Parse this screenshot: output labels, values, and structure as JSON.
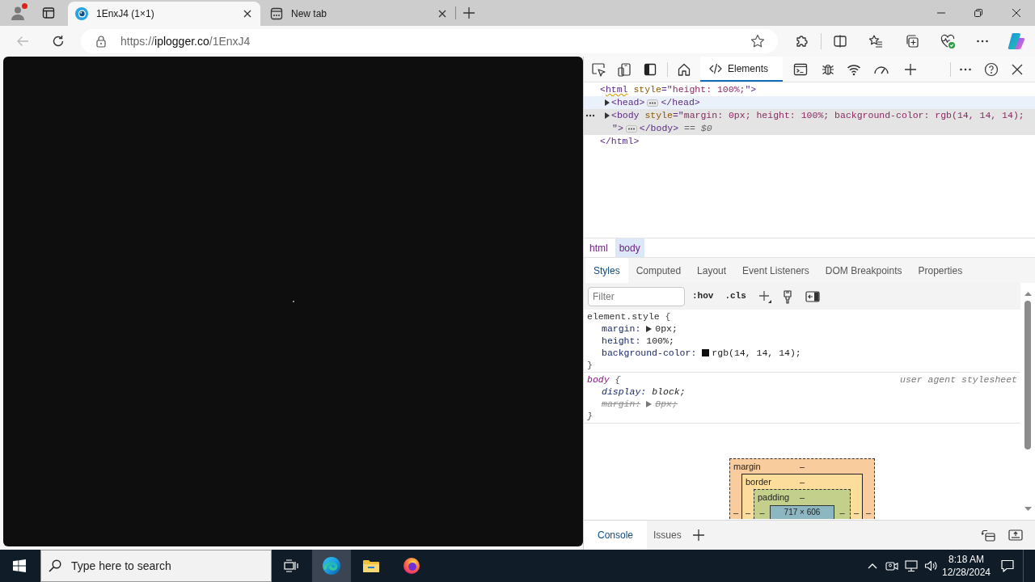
{
  "browser": {
    "tabs": [
      {
        "kind": "site",
        "title": "1EnxJ4 (1×1)",
        "selected": true
      },
      {
        "kind": "new_tab",
        "title": "New tab",
        "selected": false
      }
    ],
    "back_button": {
      "disabled": true
    },
    "address": {
      "scheme": "https://",
      "host": "iplogger.co",
      "path": "/1EnxJ4"
    }
  },
  "devtools": {
    "panel_tabs": [
      {
        "label": "Elements",
        "selected": true
      }
    ],
    "dom_tree": [
      {
        "lines": [
          [
            {
              "kind": "tag",
              "text": "<"
            },
            {
              "kind": "tag",
              "text": "html",
              "warning": true
            },
            {
              "kind": "attr",
              "text": " style"
            },
            {
              "kind": "punct",
              "text": "=\""
            },
            {
              "kind": "value",
              "text": "height: 100%;"
            },
            {
              "kind": "punct",
              "text": "\">"
            }
          ]
        ],
        "selected": false,
        "hovered": false,
        "children": [
          {
            "lines": [
              [
                {
                  "kind": "tag",
                  "text": "<head>"
                },
                {
                  "kind": "ellipsis"
                },
                {
                  "kind": "tag",
                  "text": "</head>"
                }
              ]
            ],
            "expanded": false,
            "selected": false,
            "hovered": true
          },
          {
            "lines": [
              [
                {
                  "kind": "tag",
                  "text": "<body"
                },
                {
                  "kind": "attr",
                  "text": " style"
                },
                {
                  "kind": "punct",
                  "text": "=\""
                },
                {
                  "kind": "value",
                  "text": "margin: 0px; height: 100%; background-color: rgb(14, 14, 14);"
                }
              ],
              [
                {
                  "kind": "punct",
                  "text": "\">"
                },
                {
                  "kind": "ellipsis"
                },
                {
                  "kind": "tag",
                  "text": "</body>"
                },
                {
                  "kind": "note",
                  "text": " == "
                },
                {
                  "kind": "note_italic",
                  "text": "$0"
                }
              ]
            ],
            "expanded": false,
            "selected": true,
            "hovered": false
          }
        ],
        "closing": [
          {
            "kind": "tag",
            "text": "</html>"
          }
        ]
      }
    ],
    "breadcrumbs": [
      {
        "label": "html",
        "selected": false
      },
      {
        "label": "body",
        "selected": true
      }
    ],
    "sidebar_tabs": [
      {
        "label": "Styles",
        "selected": true
      },
      {
        "label": "Computed",
        "selected": false
      },
      {
        "label": "Layout",
        "selected": false
      },
      {
        "label": "Event Listeners",
        "selected": false
      },
      {
        "label": "DOM Breakpoints",
        "selected": false
      },
      {
        "label": "Properties",
        "selected": false
      }
    ],
    "filter": {
      "placeholder": "Filter"
    },
    "style_toggles": [
      ":hov",
      ".cls"
    ],
    "rules": [
      {
        "selector": "element.style",
        "user_agent": false,
        "open": "{",
        "close": "}",
        "properties": [
          {
            "name": "margin:",
            "value": "0px;",
            "expandable": true,
            "overridden": false
          },
          {
            "name": "height:",
            "value": "100%;",
            "expandable": false,
            "overridden": false
          },
          {
            "name": "background-color:",
            "value": "rgb(14, 14, 14);",
            "expandable": false,
            "overridden": false,
            "color": "#0e0e0e"
          }
        ]
      },
      {
        "selector": "body",
        "user_agent": true,
        "source": "user agent stylesheet",
        "open": "{",
        "close": "}",
        "properties": [
          {
            "name": "display:",
            "value": "block;",
            "expandable": false,
            "overridden": false
          },
          {
            "name": "margin:",
            "value": "8px;",
            "expandable": true,
            "overridden": true
          }
        ]
      }
    ],
    "box_model": {
      "layers": [
        {
          "kind": "margin",
          "label": "margin",
          "top": "–",
          "left": "–"
        },
        {
          "kind": "border",
          "label": "border",
          "top": "–",
          "left": "–"
        },
        {
          "kind": "padding",
          "label": "padding",
          "top": "–",
          "left": "–"
        }
      ],
      "content": "717 × 606",
      "right": [
        "–",
        "–",
        "–"
      ]
    },
    "drawer_tabs": [
      {
        "label": "Console",
        "selected": true
      },
      {
        "label": "Issues",
        "selected": false
      }
    ]
  },
  "taskbar": {
    "search": {
      "placeholder": "Type here to search"
    },
    "apps": [
      {
        "kind": "edge",
        "active": true
      },
      {
        "kind": "folder",
        "active": false
      },
      {
        "kind": "firefox",
        "active": false
      }
    ],
    "time": "8:18 AM",
    "date": "12/28/2024"
  }
}
